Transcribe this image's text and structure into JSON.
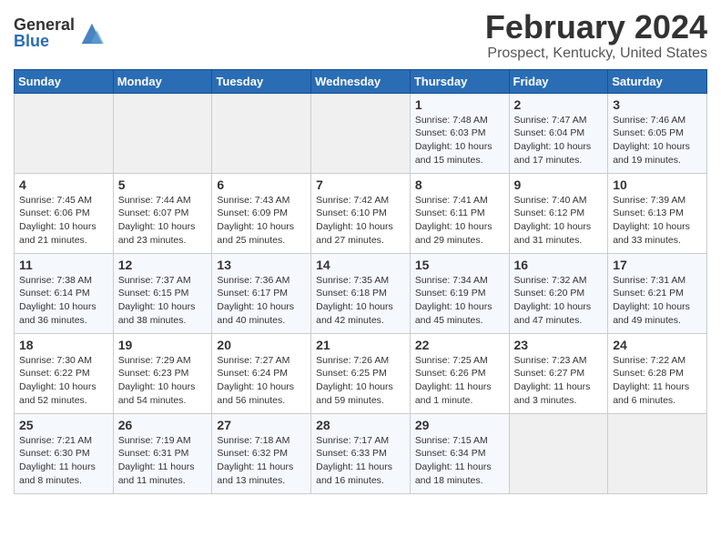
{
  "header": {
    "logo": {
      "general": "General",
      "blue": "Blue",
      "icon_title": "GeneralBlue logo"
    },
    "title": "February 2024",
    "subtitle": "Prospect, Kentucky, United States"
  },
  "weekdays": [
    "Sunday",
    "Monday",
    "Tuesday",
    "Wednesday",
    "Thursday",
    "Friday",
    "Saturday"
  ],
  "weeks": [
    [
      {
        "num": "",
        "info": ""
      },
      {
        "num": "",
        "info": ""
      },
      {
        "num": "",
        "info": ""
      },
      {
        "num": "",
        "info": ""
      },
      {
        "num": "1",
        "info": "Sunrise: 7:48 AM\nSunset: 6:03 PM\nDaylight: 10 hours\nand 15 minutes."
      },
      {
        "num": "2",
        "info": "Sunrise: 7:47 AM\nSunset: 6:04 PM\nDaylight: 10 hours\nand 17 minutes."
      },
      {
        "num": "3",
        "info": "Sunrise: 7:46 AM\nSunset: 6:05 PM\nDaylight: 10 hours\nand 19 minutes."
      }
    ],
    [
      {
        "num": "4",
        "info": "Sunrise: 7:45 AM\nSunset: 6:06 PM\nDaylight: 10 hours\nand 21 minutes."
      },
      {
        "num": "5",
        "info": "Sunrise: 7:44 AM\nSunset: 6:07 PM\nDaylight: 10 hours\nand 23 minutes."
      },
      {
        "num": "6",
        "info": "Sunrise: 7:43 AM\nSunset: 6:09 PM\nDaylight: 10 hours\nand 25 minutes."
      },
      {
        "num": "7",
        "info": "Sunrise: 7:42 AM\nSunset: 6:10 PM\nDaylight: 10 hours\nand 27 minutes."
      },
      {
        "num": "8",
        "info": "Sunrise: 7:41 AM\nSunset: 6:11 PM\nDaylight: 10 hours\nand 29 minutes."
      },
      {
        "num": "9",
        "info": "Sunrise: 7:40 AM\nSunset: 6:12 PM\nDaylight: 10 hours\nand 31 minutes."
      },
      {
        "num": "10",
        "info": "Sunrise: 7:39 AM\nSunset: 6:13 PM\nDaylight: 10 hours\nand 33 minutes."
      }
    ],
    [
      {
        "num": "11",
        "info": "Sunrise: 7:38 AM\nSunset: 6:14 PM\nDaylight: 10 hours\nand 36 minutes."
      },
      {
        "num": "12",
        "info": "Sunrise: 7:37 AM\nSunset: 6:15 PM\nDaylight: 10 hours\nand 38 minutes."
      },
      {
        "num": "13",
        "info": "Sunrise: 7:36 AM\nSunset: 6:17 PM\nDaylight: 10 hours\nand 40 minutes."
      },
      {
        "num": "14",
        "info": "Sunrise: 7:35 AM\nSunset: 6:18 PM\nDaylight: 10 hours\nand 42 minutes."
      },
      {
        "num": "15",
        "info": "Sunrise: 7:34 AM\nSunset: 6:19 PM\nDaylight: 10 hours\nand 45 minutes."
      },
      {
        "num": "16",
        "info": "Sunrise: 7:32 AM\nSunset: 6:20 PM\nDaylight: 10 hours\nand 47 minutes."
      },
      {
        "num": "17",
        "info": "Sunrise: 7:31 AM\nSunset: 6:21 PM\nDaylight: 10 hours\nand 49 minutes."
      }
    ],
    [
      {
        "num": "18",
        "info": "Sunrise: 7:30 AM\nSunset: 6:22 PM\nDaylight: 10 hours\nand 52 minutes."
      },
      {
        "num": "19",
        "info": "Sunrise: 7:29 AM\nSunset: 6:23 PM\nDaylight: 10 hours\nand 54 minutes."
      },
      {
        "num": "20",
        "info": "Sunrise: 7:27 AM\nSunset: 6:24 PM\nDaylight: 10 hours\nand 56 minutes."
      },
      {
        "num": "21",
        "info": "Sunrise: 7:26 AM\nSunset: 6:25 PM\nDaylight: 10 hours\nand 59 minutes."
      },
      {
        "num": "22",
        "info": "Sunrise: 7:25 AM\nSunset: 6:26 PM\nDaylight: 11 hours\nand 1 minute."
      },
      {
        "num": "23",
        "info": "Sunrise: 7:23 AM\nSunset: 6:27 PM\nDaylight: 11 hours\nand 3 minutes."
      },
      {
        "num": "24",
        "info": "Sunrise: 7:22 AM\nSunset: 6:28 PM\nDaylight: 11 hours\nand 6 minutes."
      }
    ],
    [
      {
        "num": "25",
        "info": "Sunrise: 7:21 AM\nSunset: 6:30 PM\nDaylight: 11 hours\nand 8 minutes."
      },
      {
        "num": "26",
        "info": "Sunrise: 7:19 AM\nSunset: 6:31 PM\nDaylight: 11 hours\nand 11 minutes."
      },
      {
        "num": "27",
        "info": "Sunrise: 7:18 AM\nSunset: 6:32 PM\nDaylight: 11 hours\nand 13 minutes."
      },
      {
        "num": "28",
        "info": "Sunrise: 7:17 AM\nSunset: 6:33 PM\nDaylight: 11 hours\nand 16 minutes."
      },
      {
        "num": "29",
        "info": "Sunrise: 7:15 AM\nSunset: 6:34 PM\nDaylight: 11 hours\nand 18 minutes."
      },
      {
        "num": "",
        "info": ""
      },
      {
        "num": "",
        "info": ""
      }
    ]
  ]
}
